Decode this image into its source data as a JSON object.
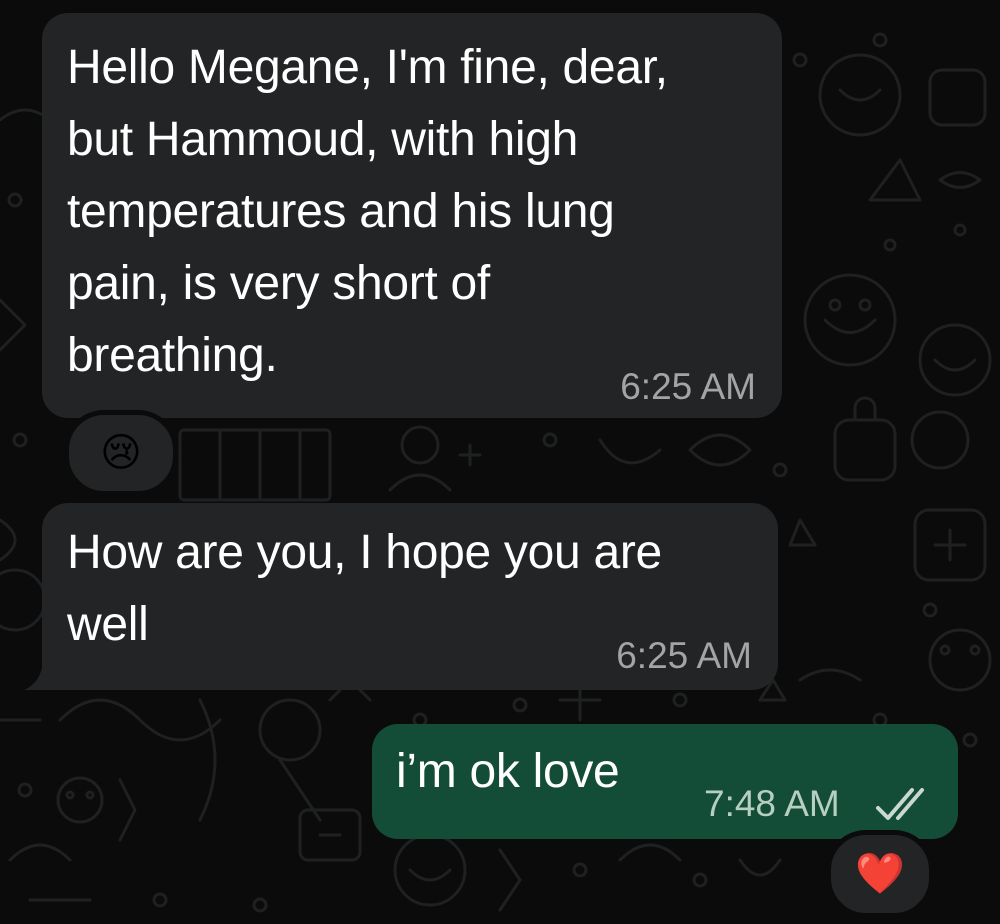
{
  "colors": {
    "incoming_bubble": "#232425",
    "outgoing_bubble": "#144d37",
    "background": "#0b0b0b",
    "read_ticks": "#c9d9d1"
  },
  "messages": [
    {
      "direction": "incoming",
      "text": "Hello Megane, I'm fine, dear,\nbut Hammoud, with high\ntemperatures and his lung\npain, is very short of\nbreathing.",
      "time": "6:25 AM",
      "reaction": "😢"
    },
    {
      "direction": "incoming",
      "text": "How are you, I hope you are\nwell",
      "time": "6:25 AM"
    },
    {
      "direction": "outgoing",
      "text": "i’m ok love",
      "time": "7:48 AM",
      "status_icon": "double-check-read-icon",
      "reaction": "❤️"
    }
  ]
}
